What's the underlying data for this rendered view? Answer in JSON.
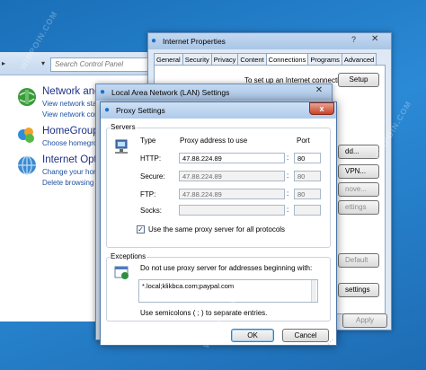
{
  "control_panel": {
    "search_placeholder": "Search Control Panel",
    "sections": [
      {
        "title": "Network and",
        "links": [
          "View network sta",
          "View network cor"
        ]
      },
      {
        "title": "HomeGroup",
        "links": [
          "Choose homegro"
        ]
      },
      {
        "title": "Internet Optic",
        "links": [
          "Change your hor",
          "Delete browsing"
        ]
      }
    ]
  },
  "internet_properties": {
    "title": "Internet Properties",
    "help_icon": "?",
    "tabs": [
      "General",
      "Security",
      "Privacy",
      "Content",
      "Connections",
      "Programs",
      "Advanced"
    ],
    "active_tab": "Connections",
    "setup_text": "To set up an Internet connection, click",
    "setup_button": "Setup",
    "fragments": {
      "add": "dd...",
      "vpn": "VPN...",
      "remove": "nove...",
      "settings1": "ettings",
      "default": "Default",
      "settings2": "settings"
    },
    "apply_button": "Apply"
  },
  "lan_settings": {
    "title": "Local Area Network (LAN) Settings"
  },
  "proxy_settings": {
    "title": "Proxy Settings",
    "close_glyph": "x",
    "servers_label": "Servers",
    "col_type": "Type",
    "col_address": "Proxy address to use",
    "col_port": "Port",
    "rows": [
      {
        "type": "HTTP:",
        "address": "47.88.224.89",
        "port": "80",
        "enabled": true
      },
      {
        "type": "Secure:",
        "address": "47.88.224.89",
        "port": "80",
        "enabled": false
      },
      {
        "type": "FTP:",
        "address": "47.88.224.89",
        "port": "80",
        "enabled": false
      },
      {
        "type": "Socks:",
        "address": "",
        "port": "",
        "enabled": false
      }
    ],
    "same_proxy_label": "Use the same proxy server for all protocols",
    "same_proxy_checked": true,
    "exceptions_label": "Exceptions",
    "exceptions_desc": "Do not use proxy server for addresses beginning with:",
    "exceptions_value": "*.local;klikbca.com;paypal.com",
    "semicolons_note": "Use semicolons ( ; ) to separate entries.",
    "ok_button": "OK",
    "cancel_button": "Cancel"
  },
  "watermark": "WINPOIN.COM",
  "colors": {
    "desktop": "#2b8ad6",
    "link_blue": "#1e50a2",
    "close_red": "#c7432a"
  }
}
